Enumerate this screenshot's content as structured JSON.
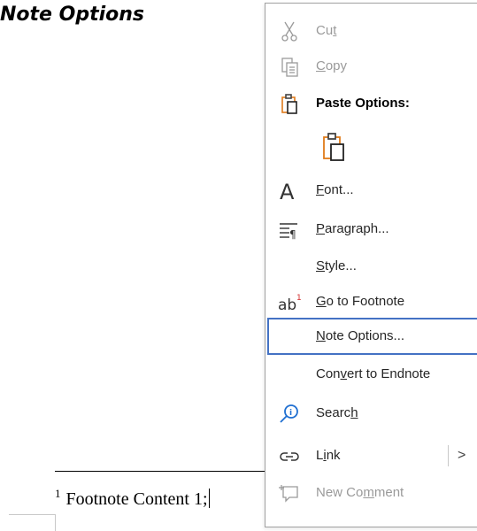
{
  "document": {
    "heading": "Note Options",
    "footnote_number": "1",
    "footnote_text": "Footnote Content 1;"
  },
  "menu": {
    "cut": {
      "pre": "Cu",
      "key": "t",
      "post": ""
    },
    "copy": {
      "pre": "",
      "key": "C",
      "post": "opy"
    },
    "paste_options": "Paste Options:",
    "font": {
      "pre": "",
      "key": "F",
      "post": "ont..."
    },
    "paragraph": {
      "pre": "",
      "key": "P",
      "post": "aragraph..."
    },
    "style": {
      "pre": "",
      "key": "S",
      "post": "tyle..."
    },
    "go_to_footnote": {
      "pre": "",
      "key": "G",
      "post": "o to Footnote"
    },
    "note_options": {
      "pre": "",
      "key": "N",
      "post": "ote Options..."
    },
    "convert_to_endnote": {
      "pre": "Con",
      "key": "v",
      "post": "ert to Endnote"
    },
    "search": {
      "pre": "Searc",
      "key": "h",
      "post": ""
    },
    "link": {
      "pre": "L",
      "key": "i",
      "post": "nk"
    },
    "link_arrow": ">",
    "new_comment": {
      "pre": "New Co",
      "key": "m",
      "post": "ment"
    }
  },
  "icons": {
    "cut": "scissors-icon",
    "copy": "copy-icon",
    "paste": "clipboard-icon",
    "font": "font-a-icon",
    "paragraph": "paragraph-icon",
    "footnote": "footnote-ab-icon",
    "search": "search-icon",
    "link": "link-icon",
    "comment": "new-comment-icon"
  },
  "colors": {
    "selection_border": "#4472c4",
    "paste_accent": "#e07b1a",
    "search_accent": "#1f6fd1",
    "footnote_red": "#d32f2f"
  }
}
